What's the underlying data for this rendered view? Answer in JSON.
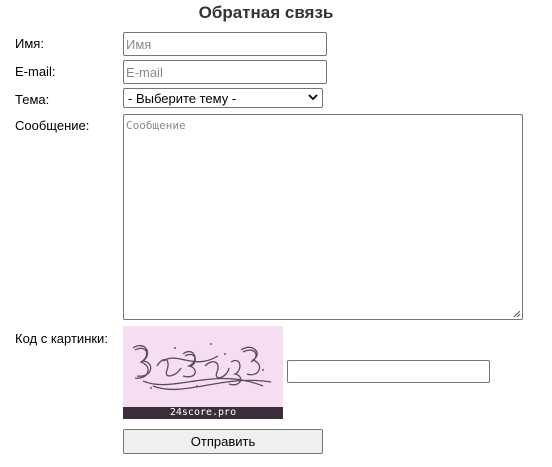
{
  "form": {
    "title": "Обратная связь",
    "name": {
      "label": "Имя:",
      "placeholder": "Имя"
    },
    "email": {
      "label": "E-mail:",
      "placeholder": "E-mail"
    },
    "topic": {
      "label": "Тема:",
      "selected": "- Выберите тему -"
    },
    "message": {
      "label": "Сообщение:",
      "placeholder": "Сообщение"
    },
    "captcha": {
      "label": "Код с картинки:",
      "brand": "24score.pro",
      "value": ""
    },
    "submit_label": "Отправить"
  },
  "icons": {
    "select_arrow": "chevron-down-icon",
    "resize": "resize-grip-icon"
  },
  "colors": {
    "captcha_bg": "#f6def2",
    "captcha_band": "#3a2f3a",
    "title": "#333333"
  }
}
